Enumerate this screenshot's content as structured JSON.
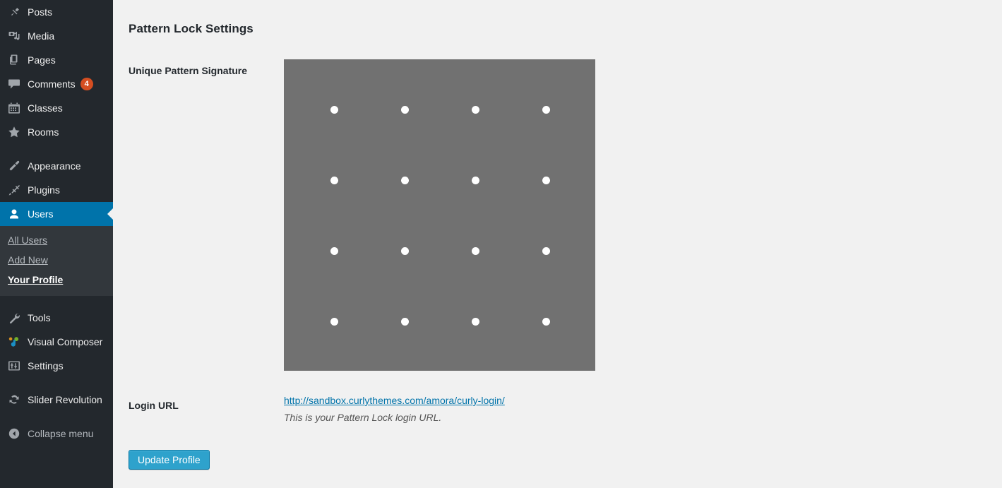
{
  "sidebar": {
    "groups": [
      {
        "items": [
          {
            "label": "Posts",
            "icon": "pushpin-icon",
            "name": "sidebar-item-posts"
          },
          {
            "label": "Media",
            "icon": "media-icon",
            "name": "sidebar-item-media"
          },
          {
            "label": "Pages",
            "icon": "pages-icon",
            "name": "sidebar-item-pages"
          },
          {
            "label": "Comments",
            "icon": "comment-bubble-icon",
            "name": "sidebar-item-comments",
            "badge": "4"
          },
          {
            "label": "Classes",
            "icon": "calendar-icon",
            "name": "sidebar-item-classes"
          },
          {
            "label": "Rooms",
            "icon": "star-icon",
            "name": "sidebar-item-rooms"
          }
        ]
      },
      {
        "items": [
          {
            "label": "Appearance",
            "icon": "paintbrush-icon",
            "name": "sidebar-item-appearance"
          },
          {
            "label": "Plugins",
            "icon": "plug-icon",
            "name": "sidebar-item-plugins"
          },
          {
            "label": "Users",
            "icon": "user-icon",
            "name": "sidebar-item-users",
            "current": true
          }
        ]
      },
      {
        "items": [
          {
            "label": "Tools",
            "icon": "wrench-icon",
            "name": "sidebar-item-tools"
          },
          {
            "label": "Visual Composer",
            "icon": "visual-composer-icon",
            "name": "sidebar-item-visual-composer"
          },
          {
            "label": "Settings",
            "icon": "sliders-icon",
            "name": "sidebar-item-settings"
          }
        ]
      },
      {
        "items": [
          {
            "label": "Slider Revolution",
            "icon": "refresh-icon",
            "name": "sidebar-item-slider-revolution"
          }
        ]
      }
    ],
    "submenu": {
      "items": [
        {
          "label": "All Users",
          "name": "submenu-item-all-users"
        },
        {
          "label": "Add New",
          "name": "submenu-item-add-new"
        },
        {
          "label": "Your Profile",
          "name": "submenu-item-your-profile",
          "current": true
        }
      ]
    },
    "collapse": {
      "label": "Collapse menu",
      "icon": "collapse-arrow-icon"
    }
  },
  "main": {
    "section_title": "Pattern Lock Settings",
    "pattern_signature_label": "Unique Pattern Signature",
    "login_url_label": "Login URL",
    "login_url_value": "http://sandbox.curlythemes.com/amora/curly-login/",
    "login_url_description": "This is your Pattern Lock login URL.",
    "update_button_label": "Update Profile",
    "pattern_lock": {
      "background_color": "#717171",
      "dot_color": "#ffffff",
      "grid_columns": 4,
      "grid_rows": 4,
      "dot_xs": [
        71,
        171,
        271,
        371
      ],
      "dot_ys": [
        71,
        171,
        271,
        371
      ],
      "dot_diameter": 11,
      "selected_dots": []
    }
  },
  "colors": {
    "sidebar_bg": "#23282d",
    "submenu_bg": "#32373c",
    "active_blue": "#0073aa",
    "content_bg": "#f1f1f1",
    "link_blue": "#0073aa",
    "button_blue": "#2ea2cc",
    "badge_orange": "#d54e21"
  }
}
